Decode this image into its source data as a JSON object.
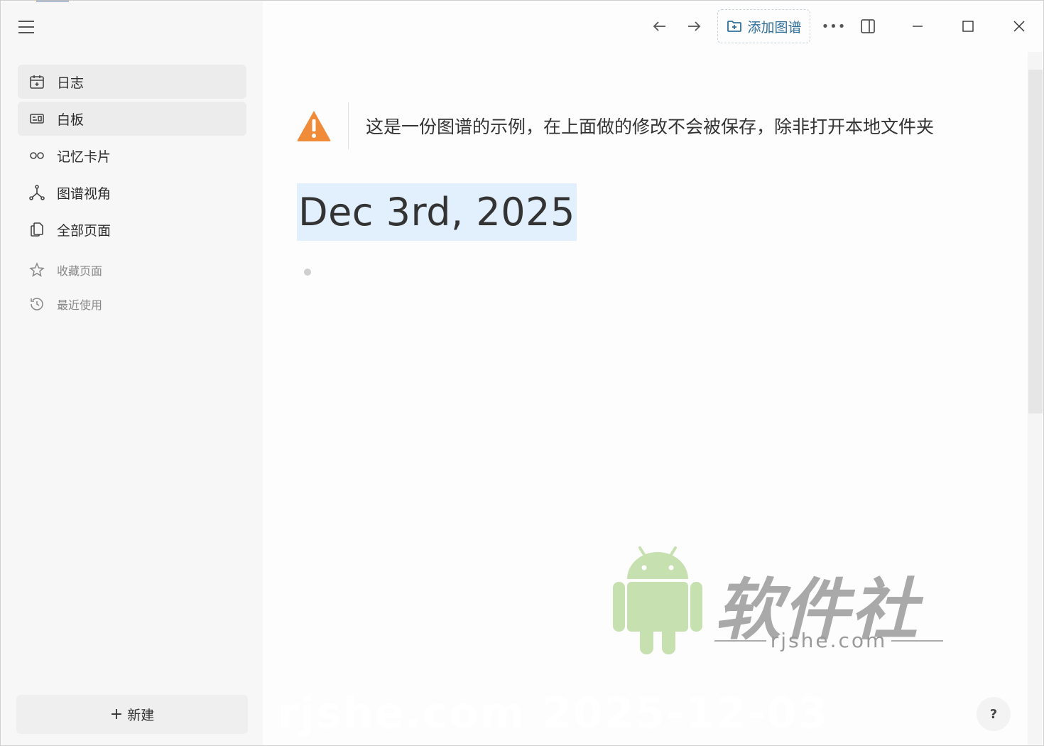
{
  "sidebar": {
    "nav": [
      {
        "label": "日志",
        "icon": "calendar-icon",
        "active": true
      },
      {
        "label": "白板",
        "icon": "whiteboard-icon",
        "active": true
      },
      {
        "label": "记忆卡片",
        "icon": "infinity-icon",
        "active": false
      },
      {
        "label": "图谱视角",
        "icon": "graph-icon",
        "active": false
      },
      {
        "label": "全部页面",
        "icon": "pages-icon",
        "active": false
      }
    ],
    "favorites_label": "收藏页面",
    "recent_label": "最近使用",
    "new_plus": "+",
    "new_label": "新建"
  },
  "toolbar": {
    "add_graph_label": "添加图谱",
    "more_label": "•••"
  },
  "main": {
    "warning_text": "这是一份图谱的示例，在上面做的修改不会被保存，除非打开本地文件夹",
    "page_title": "Dec 3rd, 2025"
  },
  "help": {
    "label": "?"
  },
  "watermark": {
    "brand": "软件社",
    "url": "rjshe.com",
    "faint": "rjshe.com 2025-12-03"
  },
  "colors": {
    "accent": "#2f6f9a",
    "warning": "#f08b3a",
    "title_highlight": "#e2effc",
    "android_green": "#c7e0b0"
  }
}
